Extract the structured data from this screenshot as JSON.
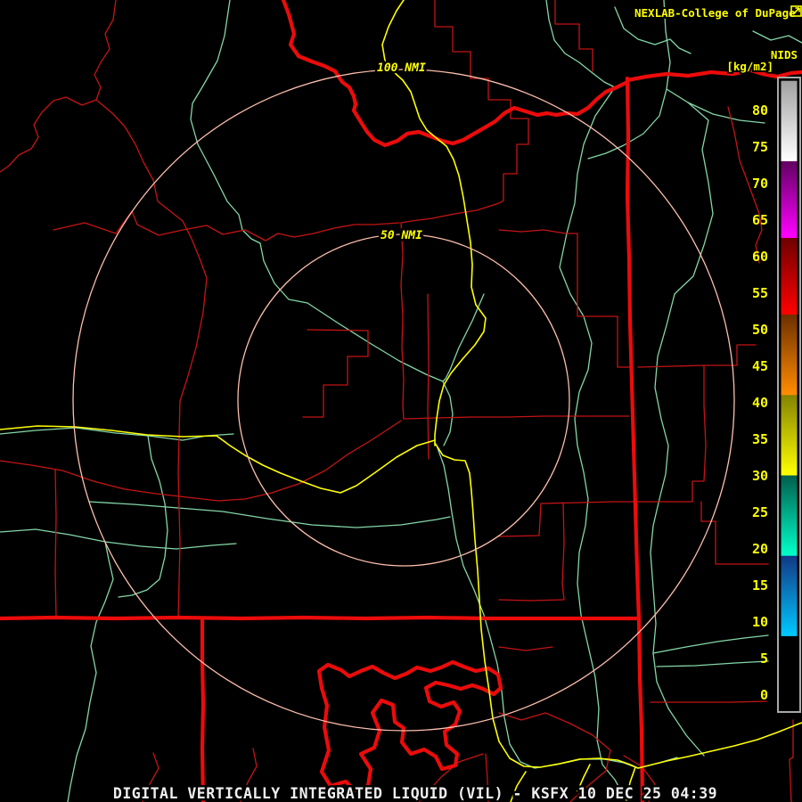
{
  "header": {
    "title": "NEXLAB-College of DuPage",
    "logo_icon": "northeast-arrow-box-icon"
  },
  "legend": {
    "product": "NIDS",
    "units": "[kg/m2]"
  },
  "range_rings": {
    "inner_label": "50 NMI",
    "outer_label": "100 NMI"
  },
  "status_bar": {
    "text": "DIGITAL VERTICALLY INTEGRATED LIQUID (VIL) - KSFX 10 DEC 25 04:39"
  },
  "colorbar": {
    "value_top": 84,
    "value_bottom": -2,
    "ticks": [
      80,
      75,
      70,
      65,
      60,
      55,
      50,
      45,
      40,
      35,
      30,
      25,
      20,
      15,
      10,
      5,
      0
    ],
    "segments": [
      {
        "from": 84,
        "to": 73,
        "color_top": "#a2a2a2",
        "color_bottom": "#ffffff"
      },
      {
        "from": 73,
        "to": 62.5,
        "color_top": "#640064",
        "color_bottom": "#ff00ff"
      },
      {
        "from": 62.5,
        "to": 52,
        "color_top": "#700000",
        "color_bottom": "#ff0000"
      },
      {
        "from": 52,
        "to": 41,
        "color_top": "#6e3000",
        "color_bottom": "#ff8c00"
      },
      {
        "from": 41,
        "to": 30,
        "color_top": "#848400",
        "color_bottom": "#ffff00"
      },
      {
        "from": 30,
        "to": 19,
        "color_top": "#00604e",
        "color_bottom": "#00ffc8"
      },
      {
        "from": 19,
        "to": 8,
        "color_top": "#123a86",
        "color_bottom": "#00c8ff"
      },
      {
        "from": 8,
        "to": -2,
        "color_top": "#000000",
        "color_bottom": "#000000"
      }
    ],
    "tick_label_color": "#ffff00"
  },
  "colors": {
    "background": "#000000",
    "county_lines": "#c41414",
    "state_borders": "#ec0b0b",
    "rivers": "#84d7a8",
    "highways": "#ffff00",
    "range_rings": "#ffbfae",
    "header_text": "#ffff00",
    "status_text": "#efefef"
  }
}
